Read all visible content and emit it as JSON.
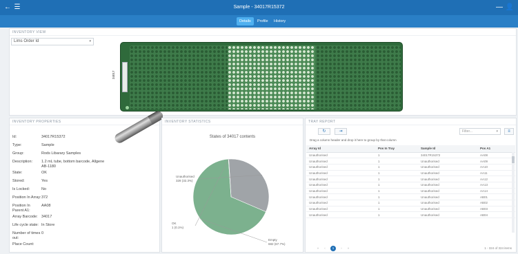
{
  "topbar": {
    "title": "Sample - 34017R15372",
    "back_icon": "←",
    "menu_icon": "☰",
    "minimize_icon": "—",
    "user_icon": "👤"
  },
  "tabs": [
    {
      "label": "Details",
      "active": true
    },
    {
      "label": "Profile",
      "active": false
    },
    {
      "label": "History",
      "active": false
    }
  ],
  "inventory_view": {
    "header": "INVENTORY VIEW",
    "order_field_value": "Lims Order Id",
    "order_field_caret": "▾",
    "tray_label": "34017"
  },
  "properties": {
    "header": "INVENTORY PROPERTIES",
    "rows": [
      {
        "key": "Id:",
        "value": "34017R15372"
      },
      {
        "key": "Type:",
        "value": "Sample"
      },
      {
        "key": "Group:",
        "value": "Rods Libarary Samples"
      },
      {
        "key": "Description:",
        "value": "1.2 mL tube, bottom barcode, Allgene AB-1180"
      },
      {
        "key": "State:",
        "value": "OK"
      },
      {
        "key": "Stored:",
        "value": "Yes"
      },
      {
        "key": "Is Locked:",
        "value": "No"
      },
      {
        "key": "Position In Array:",
        "value": "372"
      },
      {
        "key": "Position In Parent A1:",
        "value": "AA08"
      },
      {
        "key": "Array Barcode:",
        "value": "34017"
      },
      {
        "key": "Life cycle state:",
        "value": "In Store"
      },
      {
        "key": "Number of times out:",
        "value": "0"
      },
      {
        "key": "Place Count:",
        "value": ""
      }
    ]
  },
  "statistics": {
    "header": "INVENTORY STATISTICS",
    "subtitle": "States of 34017 contents",
    "chart_data": {
      "type": "pie",
      "slices": [
        {
          "label": "Unauthorised",
          "value": 328,
          "percent": "32.3%",
          "color": "#a0a4a8"
        },
        {
          "label": "Empty",
          "value": 682,
          "percent": "67.7%",
          "color": "#7cb18e"
        },
        {
          "label": "OK",
          "value": 1,
          "percent": "0.1%",
          "color": "#3d6fa3"
        }
      ],
      "labels_text": [
        [
          "Unauthorised",
          "328 (32.3%)"
        ],
        [
          "Empty",
          "682 (67.7%)"
        ],
        [
          "OK",
          "1 (0.1%)"
        ]
      ]
    }
  },
  "tray_report": {
    "header": "TRAY REPORT",
    "refresh_icon": "↻",
    "export_icon": "⇥",
    "filter_placeholder": "Filter...",
    "filter_caret": "▾",
    "menu_icon": "≡",
    "drag_hint": "Drag a column header and drop it here to group by that column",
    "columns": [
      "Array Id",
      "Pos In Tray",
      "Sample Id",
      "Pos A1"
    ],
    "rows": [
      [
        "Unauthorised",
        "1",
        "34017R15372",
        "AA08"
      ],
      [
        "Unauthorised",
        "1",
        "Unauthorised",
        "AA09"
      ],
      [
        "Unauthorised",
        "1",
        "Unauthorised",
        "AA10"
      ],
      [
        "Unauthorised",
        "1",
        "Unauthorised",
        "AA11"
      ],
      [
        "Unauthorised",
        "1",
        "Unauthorised",
        "AA12"
      ],
      [
        "Unauthorised",
        "1",
        "Unauthorised",
        "AA13"
      ],
      [
        "Unauthorised",
        "1",
        "Unauthorised",
        "AA14"
      ],
      [
        "Unauthorised",
        "1",
        "Unauthorised",
        "AB01"
      ],
      [
        "Unauthorised",
        "1",
        "Unauthorised",
        "AB02"
      ],
      [
        "Unauthorised",
        "1",
        "Unauthorised",
        "AB03"
      ],
      [
        "Unauthorised",
        "1",
        "Unauthorised",
        "AB04"
      ]
    ],
    "pager": {
      "current": "1",
      "summary": "1 - 324 of 324 items"
    }
  }
}
